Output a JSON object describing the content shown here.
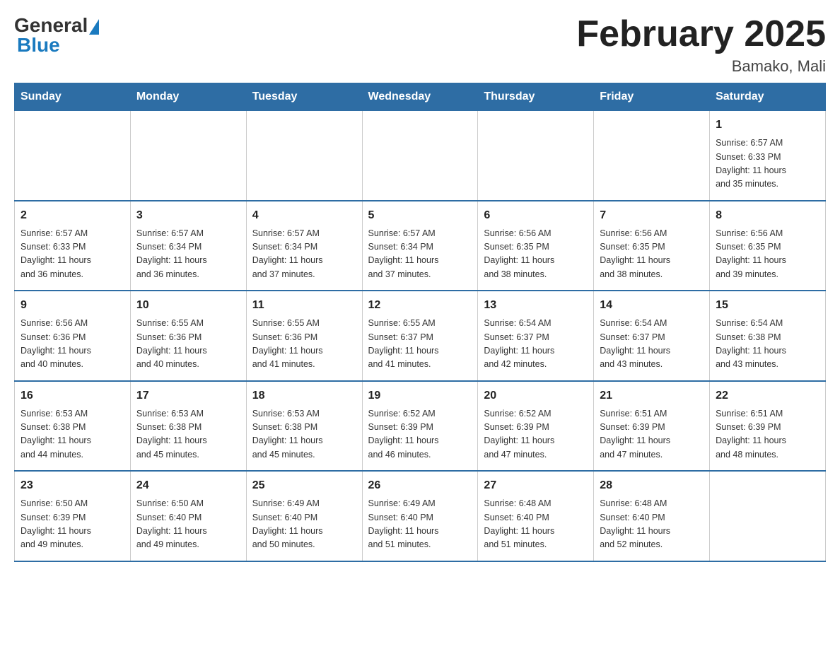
{
  "logo": {
    "general": "General",
    "blue": "Blue"
  },
  "title": "February 2025",
  "subtitle": "Bamako, Mali",
  "days_header": [
    "Sunday",
    "Monday",
    "Tuesday",
    "Wednesday",
    "Thursday",
    "Friday",
    "Saturday"
  ],
  "weeks": [
    [
      {
        "day": "",
        "info": ""
      },
      {
        "day": "",
        "info": ""
      },
      {
        "day": "",
        "info": ""
      },
      {
        "day": "",
        "info": ""
      },
      {
        "day": "",
        "info": ""
      },
      {
        "day": "",
        "info": ""
      },
      {
        "day": "1",
        "info": "Sunrise: 6:57 AM\nSunset: 6:33 PM\nDaylight: 11 hours\nand 35 minutes."
      }
    ],
    [
      {
        "day": "2",
        "info": "Sunrise: 6:57 AM\nSunset: 6:33 PM\nDaylight: 11 hours\nand 36 minutes."
      },
      {
        "day": "3",
        "info": "Sunrise: 6:57 AM\nSunset: 6:34 PM\nDaylight: 11 hours\nand 36 minutes."
      },
      {
        "day": "4",
        "info": "Sunrise: 6:57 AM\nSunset: 6:34 PM\nDaylight: 11 hours\nand 37 minutes."
      },
      {
        "day": "5",
        "info": "Sunrise: 6:57 AM\nSunset: 6:34 PM\nDaylight: 11 hours\nand 37 minutes."
      },
      {
        "day": "6",
        "info": "Sunrise: 6:56 AM\nSunset: 6:35 PM\nDaylight: 11 hours\nand 38 minutes."
      },
      {
        "day": "7",
        "info": "Sunrise: 6:56 AM\nSunset: 6:35 PM\nDaylight: 11 hours\nand 38 minutes."
      },
      {
        "day": "8",
        "info": "Sunrise: 6:56 AM\nSunset: 6:35 PM\nDaylight: 11 hours\nand 39 minutes."
      }
    ],
    [
      {
        "day": "9",
        "info": "Sunrise: 6:56 AM\nSunset: 6:36 PM\nDaylight: 11 hours\nand 40 minutes."
      },
      {
        "day": "10",
        "info": "Sunrise: 6:55 AM\nSunset: 6:36 PM\nDaylight: 11 hours\nand 40 minutes."
      },
      {
        "day": "11",
        "info": "Sunrise: 6:55 AM\nSunset: 6:36 PM\nDaylight: 11 hours\nand 41 minutes."
      },
      {
        "day": "12",
        "info": "Sunrise: 6:55 AM\nSunset: 6:37 PM\nDaylight: 11 hours\nand 41 minutes."
      },
      {
        "day": "13",
        "info": "Sunrise: 6:54 AM\nSunset: 6:37 PM\nDaylight: 11 hours\nand 42 minutes."
      },
      {
        "day": "14",
        "info": "Sunrise: 6:54 AM\nSunset: 6:37 PM\nDaylight: 11 hours\nand 43 minutes."
      },
      {
        "day": "15",
        "info": "Sunrise: 6:54 AM\nSunset: 6:38 PM\nDaylight: 11 hours\nand 43 minutes."
      }
    ],
    [
      {
        "day": "16",
        "info": "Sunrise: 6:53 AM\nSunset: 6:38 PM\nDaylight: 11 hours\nand 44 minutes."
      },
      {
        "day": "17",
        "info": "Sunrise: 6:53 AM\nSunset: 6:38 PM\nDaylight: 11 hours\nand 45 minutes."
      },
      {
        "day": "18",
        "info": "Sunrise: 6:53 AM\nSunset: 6:38 PM\nDaylight: 11 hours\nand 45 minutes."
      },
      {
        "day": "19",
        "info": "Sunrise: 6:52 AM\nSunset: 6:39 PM\nDaylight: 11 hours\nand 46 minutes."
      },
      {
        "day": "20",
        "info": "Sunrise: 6:52 AM\nSunset: 6:39 PM\nDaylight: 11 hours\nand 47 minutes."
      },
      {
        "day": "21",
        "info": "Sunrise: 6:51 AM\nSunset: 6:39 PM\nDaylight: 11 hours\nand 47 minutes."
      },
      {
        "day": "22",
        "info": "Sunrise: 6:51 AM\nSunset: 6:39 PM\nDaylight: 11 hours\nand 48 minutes."
      }
    ],
    [
      {
        "day": "23",
        "info": "Sunrise: 6:50 AM\nSunset: 6:39 PM\nDaylight: 11 hours\nand 49 minutes."
      },
      {
        "day": "24",
        "info": "Sunrise: 6:50 AM\nSunset: 6:40 PM\nDaylight: 11 hours\nand 49 minutes."
      },
      {
        "day": "25",
        "info": "Sunrise: 6:49 AM\nSunset: 6:40 PM\nDaylight: 11 hours\nand 50 minutes."
      },
      {
        "day": "26",
        "info": "Sunrise: 6:49 AM\nSunset: 6:40 PM\nDaylight: 11 hours\nand 51 minutes."
      },
      {
        "day": "27",
        "info": "Sunrise: 6:48 AM\nSunset: 6:40 PM\nDaylight: 11 hours\nand 51 minutes."
      },
      {
        "day": "28",
        "info": "Sunrise: 6:48 AM\nSunset: 6:40 PM\nDaylight: 11 hours\nand 52 minutes."
      },
      {
        "day": "",
        "info": ""
      }
    ]
  ]
}
